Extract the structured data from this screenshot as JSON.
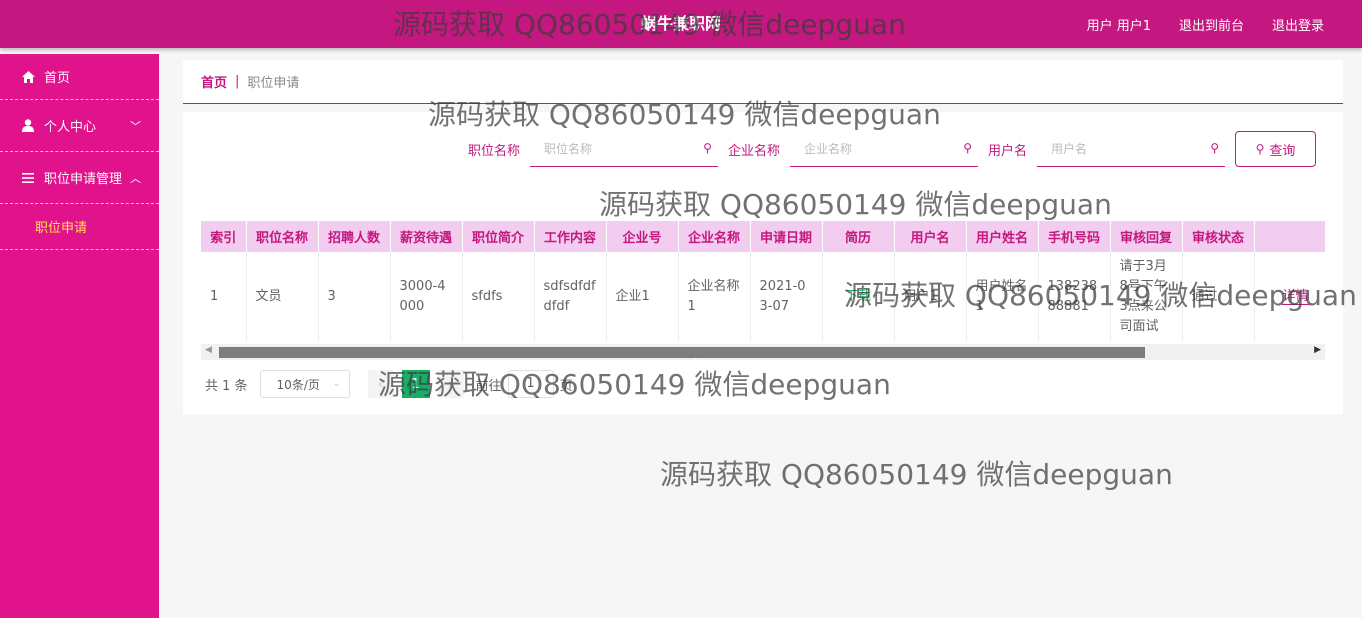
{
  "header": {
    "site_title": "蜗牛兼职网",
    "user_label": "用户 用户1",
    "back_to_front": "退出到前台",
    "logout": "退出登录"
  },
  "sidebar": {
    "items": [
      {
        "label": "首页",
        "icon": "home-icon"
      },
      {
        "label": "个人中心",
        "icon": "user-icon",
        "arrow": "﹀"
      },
      {
        "label": "职位申请管理",
        "icon": "list-icon",
        "arrow": "︿"
      }
    ],
    "sub_items": [
      {
        "label": "职位申请"
      }
    ]
  },
  "breadcrumb": {
    "home": "首页",
    "separator": "|",
    "current": "职位申请"
  },
  "search": {
    "job_name_label": "职位名称",
    "job_name_placeholder": "职位名称",
    "company_label": "企业名称",
    "company_placeholder": "企业名称",
    "username_label": "用户名",
    "username_placeholder": "用户名",
    "query_button": "查询"
  },
  "table": {
    "columns": [
      "索引",
      "职位名称",
      "招聘人数",
      "薪资待遇",
      "职位简介",
      "工作内容",
      "企业号",
      "企业名称",
      "申请日期",
      "简历",
      "用户名",
      "用户姓名",
      "手机号码",
      "审核回复",
      "审核状态",
      ""
    ],
    "rows": [
      {
        "index": "1",
        "job_name": "文员",
        "headcount": "3",
        "salary": "3000-4000",
        "intro": "sfdfs",
        "work_content": "sdfsdfdfdfdf",
        "company_no": "企业1",
        "company_name": "企业名称1",
        "apply_date": "2021-03-07",
        "resume": "下载",
        "username": "用户1",
        "real_name": "用户姓名1",
        "phone": "13823888881",
        "review_reply": "请于3月8号下午3点来公司面试",
        "review_status": "通过",
        "action": "详情"
      }
    ]
  },
  "pager": {
    "total": "共 1 条",
    "page_size": "10条/页",
    "prev": "‹",
    "current_page": "1",
    "next": "›",
    "goto_label": "前往",
    "goto_value": "1",
    "page_unit": "页"
  },
  "watermark": {
    "text": "源码获取 QQ86050149 微信deepguan"
  },
  "colors": {
    "header": "#c4177f",
    "sidebar": "#e1138c",
    "accent": "#c4177f",
    "table_header_bg": "#f2cdf0",
    "active_page": "#1aad6a"
  }
}
